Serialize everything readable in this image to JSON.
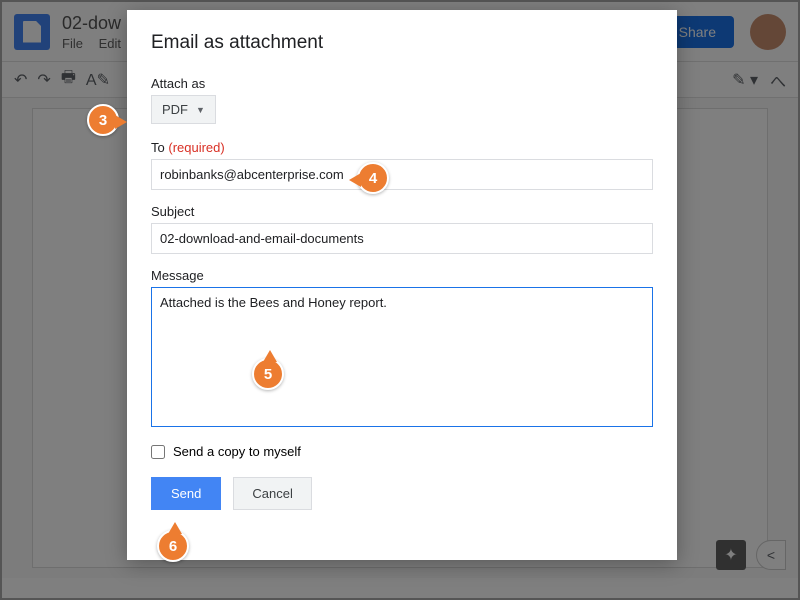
{
  "header": {
    "doc_title": "02-dow",
    "menus": [
      "File",
      "Edit"
    ]
  },
  "share_label": "Share",
  "dialog": {
    "title": "Email as attachment",
    "attach_label": "Attach as",
    "attach_value": "PDF",
    "to_label": "To",
    "to_required": "(required)",
    "to_value": "robinbanks@abcenterprise.com",
    "subject_label": "Subject",
    "subject_value": "02-download-and-email-documents",
    "message_label": "Message",
    "message_value": "Attached is the Bees and Honey report.",
    "copy_label": "Send a copy to myself",
    "send_label": "Send",
    "cancel_label": "Cancel"
  },
  "callouts": {
    "c3": "3",
    "c4": "4",
    "c5": "5",
    "c6": "6"
  }
}
